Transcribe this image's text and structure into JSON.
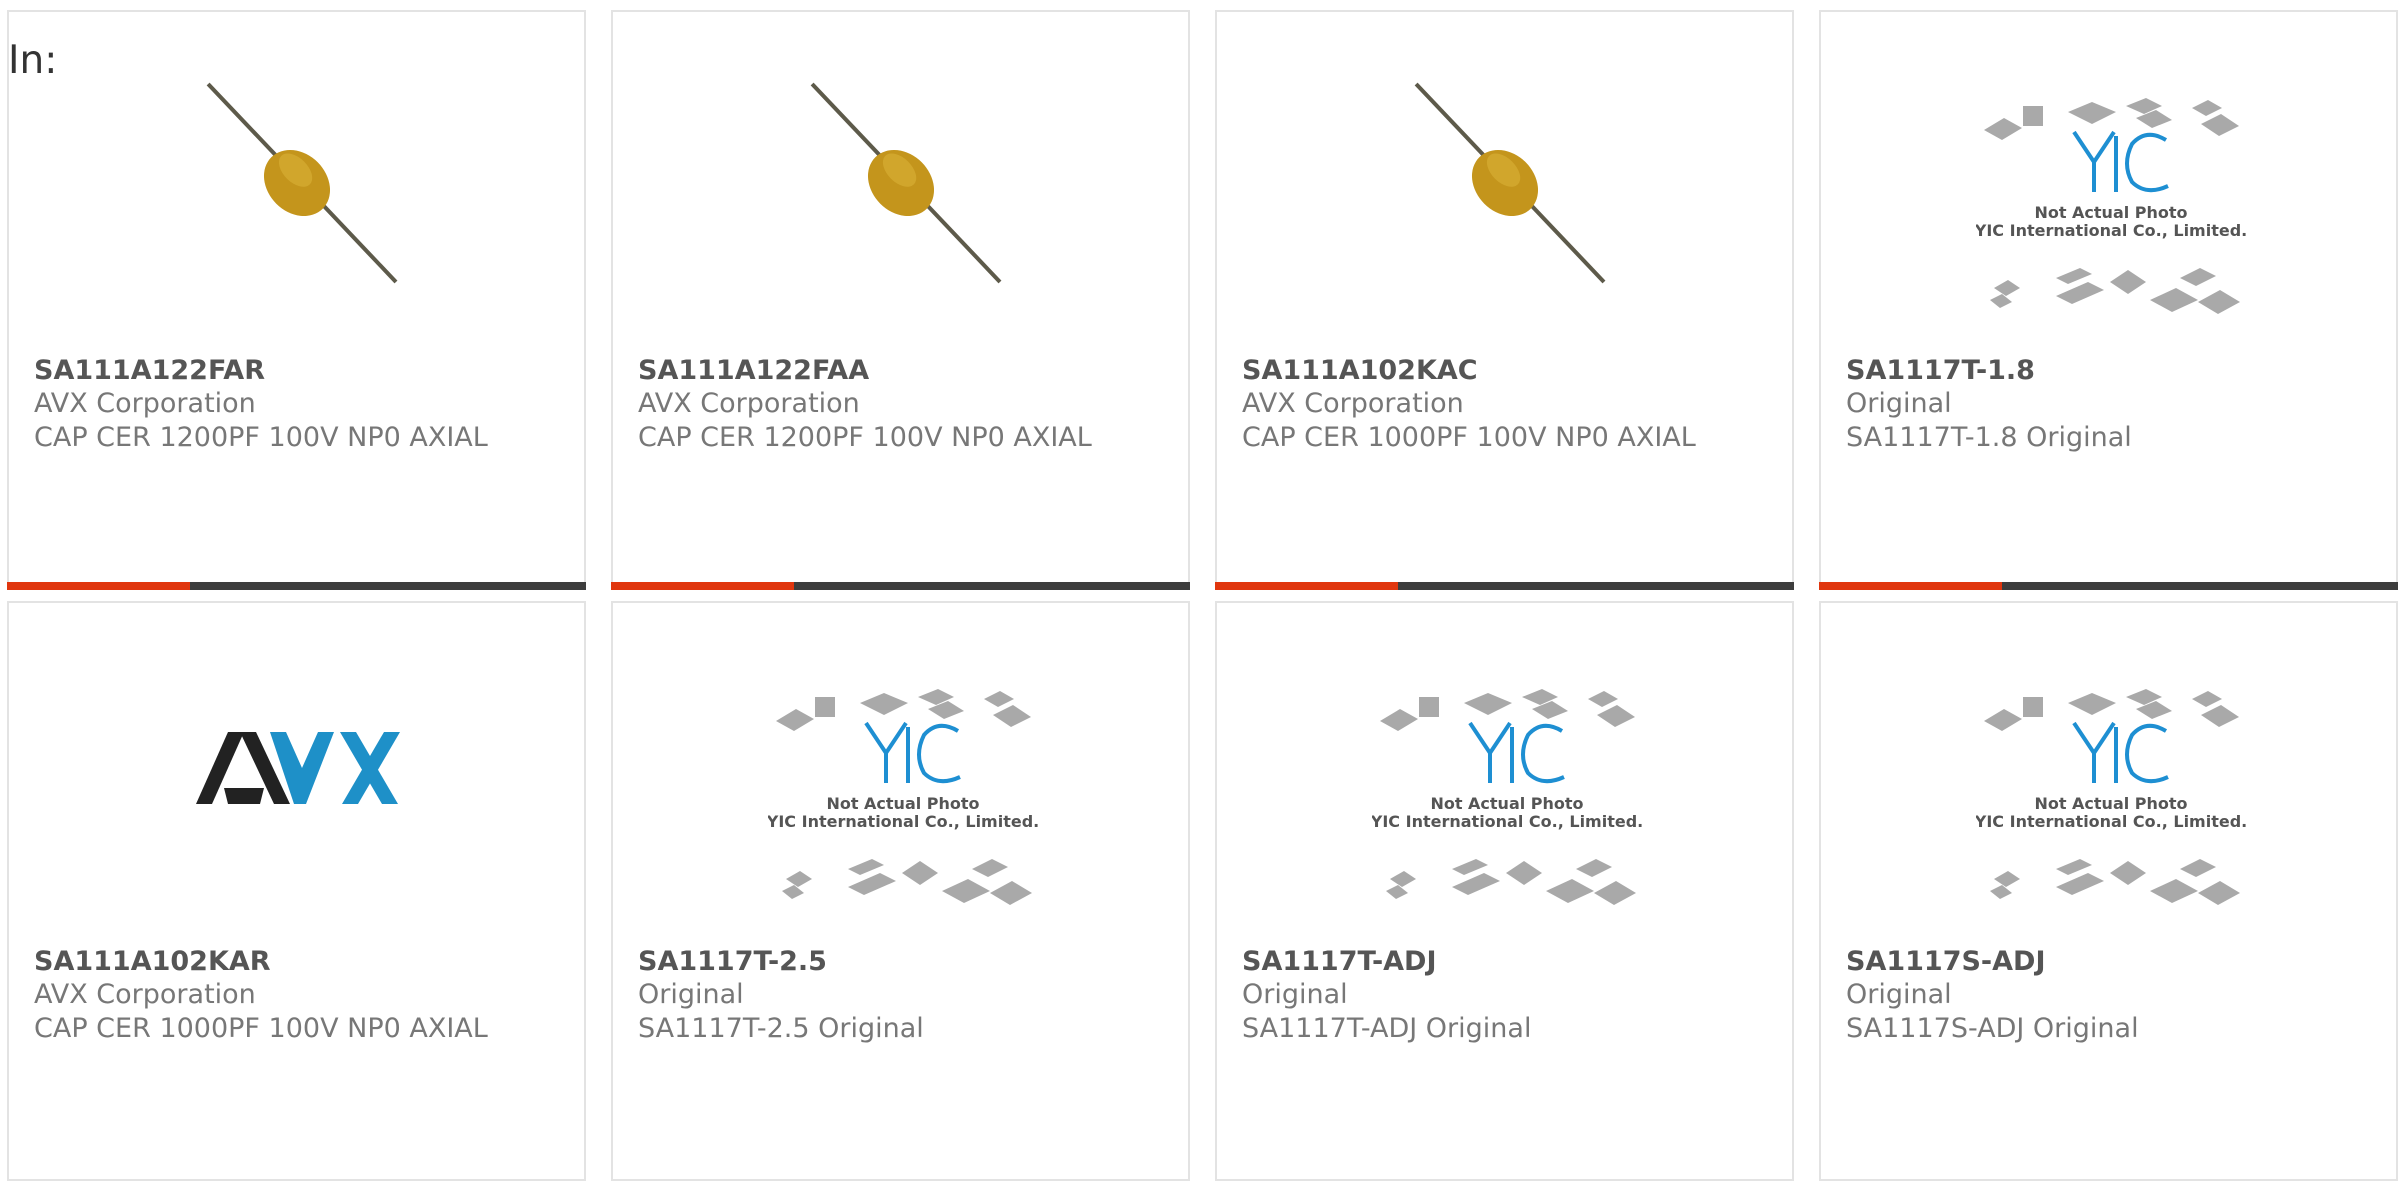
{
  "header": {
    "label": "In:"
  },
  "colors": {
    "accent": "#e0360e",
    "bar": "#3d3d3d",
    "yic_blue": "#1e8fd2",
    "avx_blue": "#1e90c8"
  },
  "products": [
    {
      "part": "SA111A122FAR",
      "maker": "AVX Corporation",
      "desc": "CAP CER 1200PF 100V NP0 AXIAL",
      "image": "axial-capacitor"
    },
    {
      "part": "SA111A122FAA",
      "maker": "AVX Corporation",
      "desc": "CAP CER 1200PF 100V NP0 AXIAL",
      "image": "axial-capacitor"
    },
    {
      "part": "SA111A102KAC",
      "maker": "AVX Corporation",
      "desc": "CAP CER 1000PF 100V NP0 AXIAL",
      "image": "axial-capacitor"
    },
    {
      "part": "SA1117T-1.8",
      "maker": "Original",
      "desc": "SA1117T-1.8 Original",
      "image": "yic-placeholder"
    },
    {
      "part": "SA111A102KAR",
      "maker": "AVX Corporation",
      "desc": "CAP CER 1000PF 100V NP0 AXIAL",
      "image": "avx-logo"
    },
    {
      "part": "SA1117T-2.5",
      "maker": "Original",
      "desc": "SA1117T-2.5 Original",
      "image": "yic-placeholder"
    },
    {
      "part": "SA1117T-ADJ",
      "maker": "Original",
      "desc": "SA1117T-ADJ Original",
      "image": "yic-placeholder"
    },
    {
      "part": "SA1117S-ADJ",
      "maker": "Original",
      "desc": "SA1117S-ADJ Original",
      "image": "yic-placeholder"
    }
  ],
  "placeholder": {
    "brand": "YIC",
    "line1": "Not Actual Photo",
    "line2": "YIC International Co., Limited."
  },
  "avx_logo": {
    "text": "AVX"
  }
}
